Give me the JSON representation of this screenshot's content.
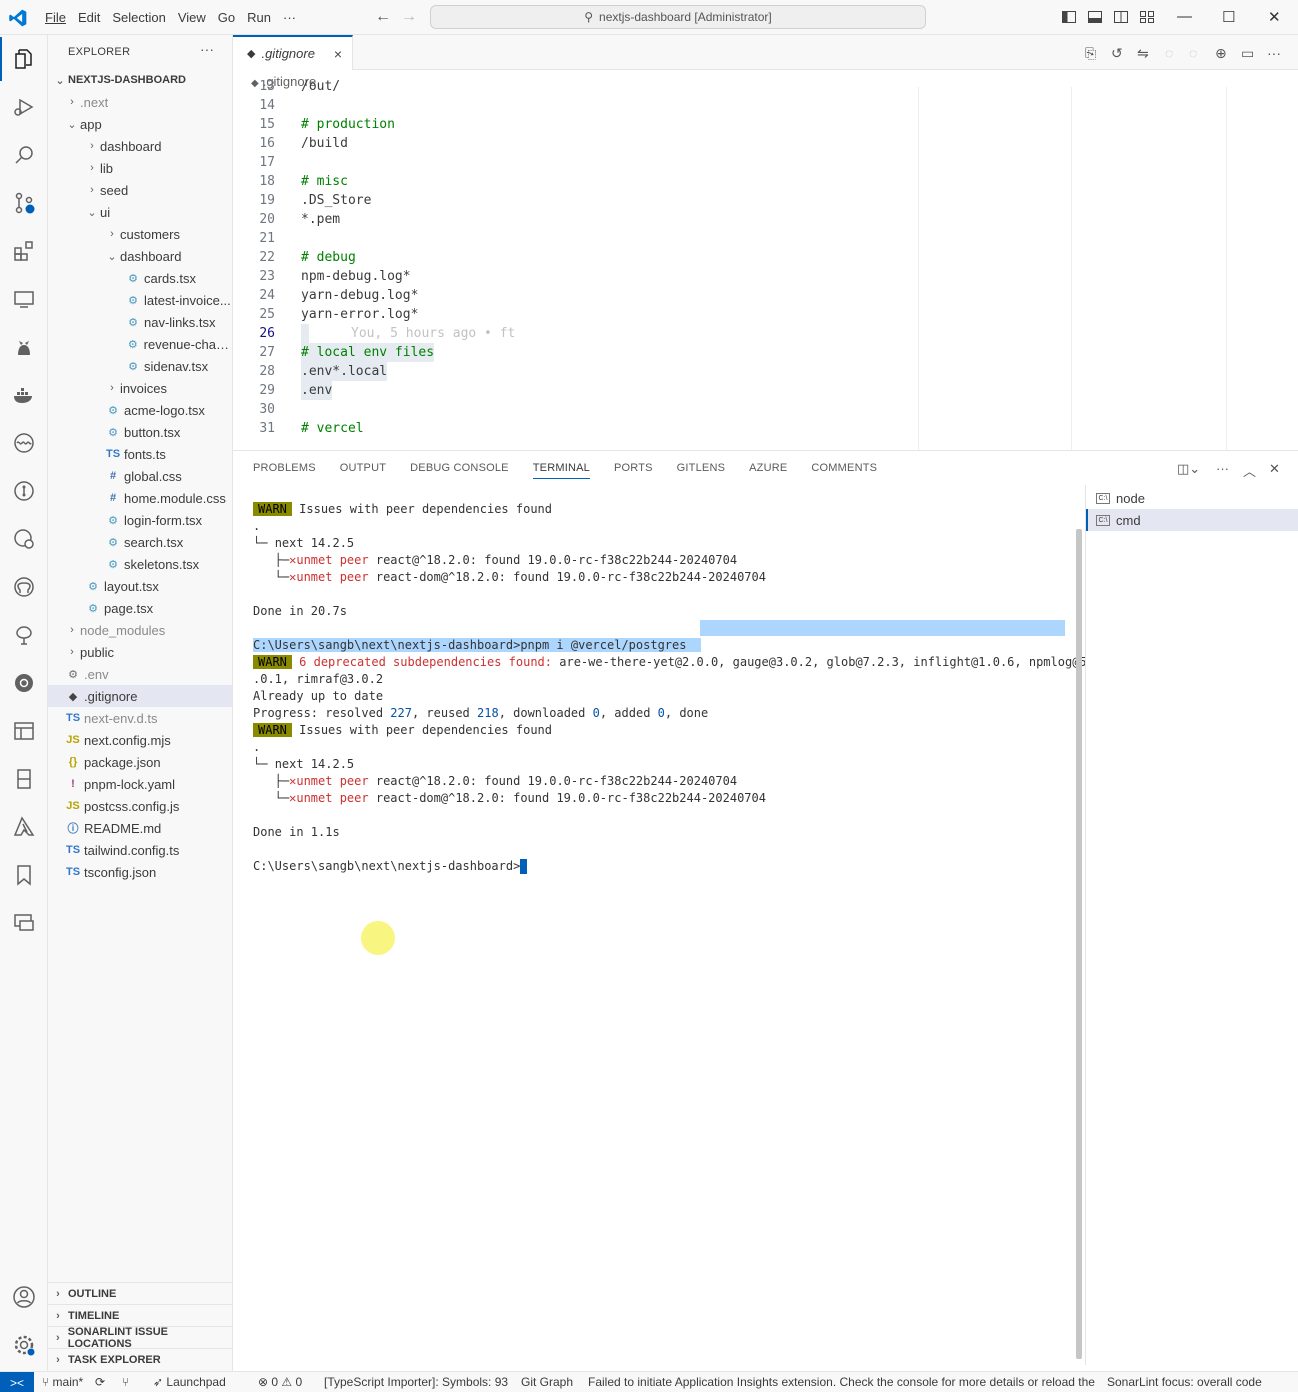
{
  "titlebar": {
    "menu": [
      "File",
      "Edit",
      "Selection",
      "View",
      "Go",
      "Run",
      "···"
    ],
    "command_center": "nextjs-dashboard [Administrator]"
  },
  "sidebar": {
    "title": "EXPLORER",
    "more": "···",
    "tree": [
      {
        "label": "NEXTJS-DASHBOARD",
        "depth": 0,
        "kind": "root",
        "chev": "⌄"
      },
      {
        "label": ".next",
        "depth": 1,
        "kind": "folder",
        "chev": "›",
        "dim": true
      },
      {
        "label": "app",
        "depth": 1,
        "kind": "folder",
        "chev": "⌄"
      },
      {
        "label": "dashboard",
        "depth": 2,
        "kind": "folder",
        "chev": "›"
      },
      {
        "label": "lib",
        "depth": 2,
        "kind": "folder",
        "chev": "›"
      },
      {
        "label": "seed",
        "depth": 2,
        "kind": "folder",
        "chev": "›"
      },
      {
        "label": "ui",
        "depth": 2,
        "kind": "folder",
        "chev": "⌄"
      },
      {
        "label": "customers",
        "depth": 3,
        "kind": "folder",
        "chev": "›"
      },
      {
        "label": "dashboard",
        "depth": 3,
        "kind": "folder",
        "chev": "⌄"
      },
      {
        "label": "cards.tsx",
        "depth": 4,
        "kind": "react"
      },
      {
        "label": "latest-invoice...",
        "depth": 4,
        "kind": "react"
      },
      {
        "label": "nav-links.tsx",
        "depth": 4,
        "kind": "react"
      },
      {
        "label": "revenue-chart...",
        "depth": 4,
        "kind": "react"
      },
      {
        "label": "sidenav.tsx",
        "depth": 4,
        "kind": "react"
      },
      {
        "label": "invoices",
        "depth": 3,
        "kind": "folder",
        "chev": "›"
      },
      {
        "label": "acme-logo.tsx",
        "depth": 3,
        "kind": "react"
      },
      {
        "label": "button.tsx",
        "depth": 3,
        "kind": "react"
      },
      {
        "label": "fonts.ts",
        "depth": 3,
        "kind": "ts"
      },
      {
        "label": "global.css",
        "depth": 3,
        "kind": "css"
      },
      {
        "label": "home.module.css",
        "depth": 3,
        "kind": "css"
      },
      {
        "label": "login-form.tsx",
        "depth": 3,
        "kind": "react"
      },
      {
        "label": "search.tsx",
        "depth": 3,
        "kind": "react"
      },
      {
        "label": "skeletons.tsx",
        "depth": 3,
        "kind": "react"
      },
      {
        "label": "layout.tsx",
        "depth": 2,
        "kind": "react"
      },
      {
        "label": "page.tsx",
        "depth": 2,
        "kind": "react"
      },
      {
        "label": "node_modules",
        "depth": 1,
        "kind": "folder",
        "chev": "›",
        "dim": true
      },
      {
        "label": "public",
        "depth": 1,
        "kind": "folder",
        "chev": "›"
      },
      {
        "label": ".env",
        "depth": 1,
        "kind": "gear",
        "dim": true
      },
      {
        "label": ".gitignore",
        "depth": 1,
        "kind": "git",
        "selected": true
      },
      {
        "label": "next-env.d.ts",
        "depth": 1,
        "kind": "ts",
        "dim": true
      },
      {
        "label": "next.config.mjs",
        "depth": 1,
        "kind": "js"
      },
      {
        "label": "package.json",
        "depth": 1,
        "kind": "json"
      },
      {
        "label": "pnpm-lock.yaml",
        "depth": 1,
        "kind": "yaml"
      },
      {
        "label": "postcss.config.js",
        "depth": 1,
        "kind": "js"
      },
      {
        "label": "README.md",
        "depth": 1,
        "kind": "info"
      },
      {
        "label": "tailwind.config.ts",
        "depth": 1,
        "kind": "ts"
      },
      {
        "label": "tsconfig.json",
        "depth": 1,
        "kind": "tsconfig"
      }
    ],
    "sections": [
      "OUTLINE",
      "TIMELINE",
      "SONARLINT ISSUE LOCATIONS",
      "TASK EXPLORER"
    ]
  },
  "editor": {
    "tab_label": ".gitignore",
    "tab_close": "×",
    "breadcrumb": ".gitignore",
    "blame": "You, 5 hours ago • ft",
    "lines": [
      {
        "n": "13",
        "text": "/out/",
        "comment": false
      },
      {
        "n": "14",
        "text": "",
        "comment": false
      },
      {
        "n": "15",
        "text": "# production",
        "comment": true
      },
      {
        "n": "16",
        "text": "/build",
        "comment": false
      },
      {
        "n": "17",
        "text": "",
        "comment": false
      },
      {
        "n": "18",
        "text": "# misc",
        "comment": true
      },
      {
        "n": "19",
        "text": ".DS_Store",
        "comment": false
      },
      {
        "n": "20",
        "text": "*.pem",
        "comment": false
      },
      {
        "n": "21",
        "text": "",
        "comment": false
      },
      {
        "n": "22",
        "text": "# debug",
        "comment": true
      },
      {
        "n": "23",
        "text": "npm-debug.log*",
        "comment": false
      },
      {
        "n": "24",
        "text": "yarn-debug.log*",
        "comment": false
      },
      {
        "n": "25",
        "text": "yarn-error.log*",
        "comment": false
      },
      {
        "n": "26",
        "text": "",
        "comment": false,
        "current": true
      },
      {
        "n": "27",
        "text": "# local env files",
        "comment": true,
        "hl": true
      },
      {
        "n": "28",
        "text": ".env*.local",
        "comment": false,
        "hl": true
      },
      {
        "n": "29",
        "text": ".env",
        "comment": false,
        "hl": true
      },
      {
        "n": "30",
        "text": "",
        "comment": false
      },
      {
        "n": "31",
        "text": "# vercel",
        "comment": true
      }
    ]
  },
  "panel": {
    "tabs": [
      "PROBLEMS",
      "OUTPUT",
      "DEBUG CONSOLE",
      "TERMINAL",
      "PORTS",
      "GITLENS",
      "AZURE",
      "COMMENTS"
    ],
    "active_tab": "TERMINAL",
    "terminals": [
      "node",
      "cmd"
    ],
    "terminal": {
      "warn_label": "WARN",
      "peer_issues": "Issues with peer dependencies found",
      "dot": ".",
      "next_pkg": "next 14.2.5",
      "x_mark": "✕",
      "unmet_peer": "unmet peer",
      "react_req": "react@^18.2.0: found 19.0.0-rc-f38c22b244-20240704",
      "reactdom_req": "react-dom@^18.2.0: found 19.0.0-rc-f38c22b244-20240704",
      "done1": "Done in 20.7s",
      "prompt": "C:\\Users\\sangb\\next\\nextjs-dashboard>",
      "command": "pnpm i @vercel/postgres",
      "deprecated": "6 deprecated subdependencies found:",
      "deprecated_list": " are-we-there-yet@2.0.0, gauge@3.0.2, glob@7.2.3, inflight@1.0.6, npmlog@5",
      "deprecated_cont": ".0.1, rimraf@3.0.2",
      "up_to_date": "Already up to date",
      "progress_prefix": "Progress: resolved ",
      "resolved": "227",
      "reused_label": ", reused ",
      "reused": "218",
      "downloaded_label": ", downloaded ",
      "downloaded": "0",
      "added_label": ", added ",
      "added": "0",
      "done_label": ", done",
      "done2": "Done in 1.1s"
    }
  },
  "statusbar": {
    "remote": "><",
    "branch": "main*",
    "launchpad": "Launchpad",
    "errors": "0",
    "warnings": "0",
    "ts_importer": "[TypeScript Importer]: Symbols: 93",
    "git_graph": "Git Graph",
    "insights": "Failed to initiate Application Insights extension. Check the console for more details or reload the",
    "sonarlint": "SonarLint focus: overall code"
  },
  "colors": {
    "accent": "#005fb8",
    "comment": "#008000",
    "warn_bg": "#8a8a00",
    "error": "#cd3131"
  }
}
